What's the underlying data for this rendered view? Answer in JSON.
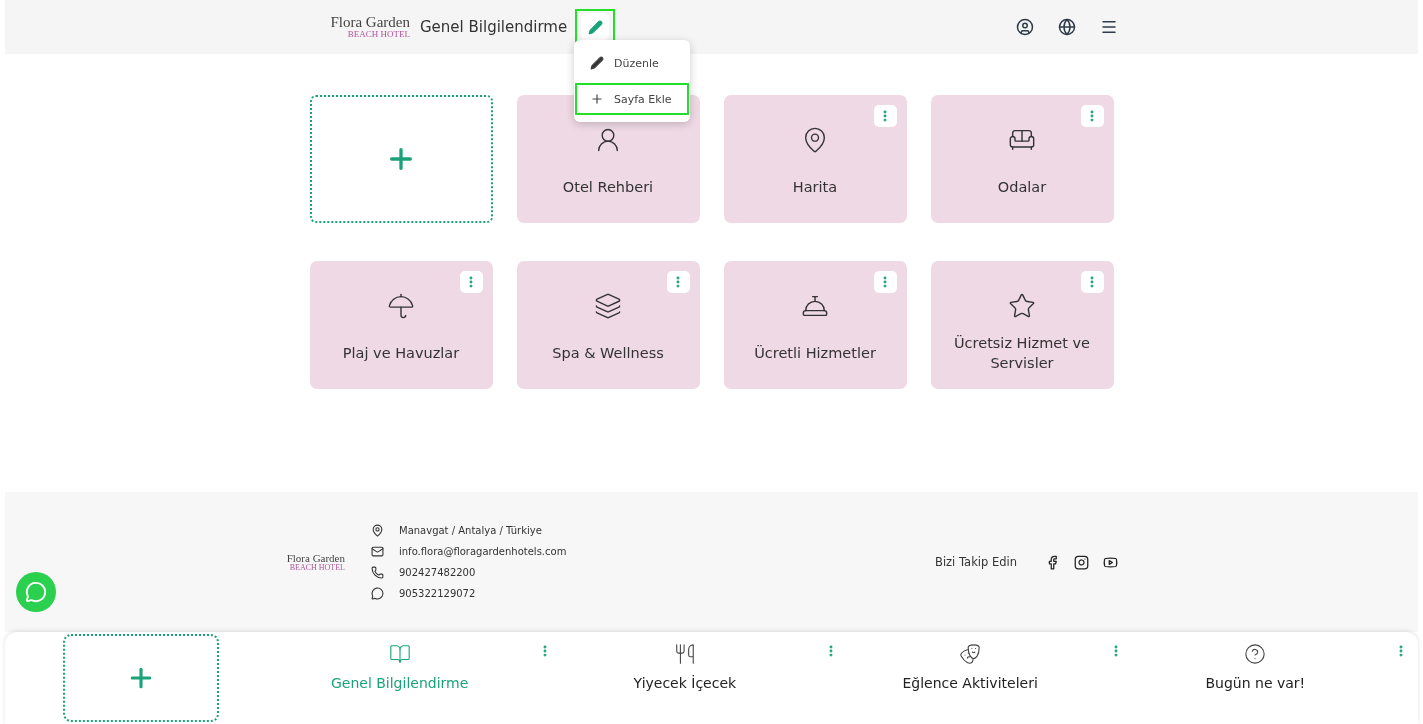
{
  "header": {
    "page_title": "Genel Bilgilendirme",
    "edit_button": {
      "highlighted": true
    },
    "logo": {
      "name": "Flora Garden",
      "sub": "BEACH HOTEL"
    }
  },
  "edit_menu": [
    {
      "label": "Düzenle",
      "kind": "edit",
      "selected": false
    },
    {
      "label": "Sayfa Ekle",
      "kind": "add",
      "selected": true
    }
  ],
  "tiles": [
    {
      "label": "Otel Rehberi"
    },
    {
      "label": "Harita"
    },
    {
      "label": "Odalar"
    },
    {
      "label": "Plaj ve Havuzlar"
    },
    {
      "label": "Spa & Wellness"
    },
    {
      "label": "Ücretli Hizmetler"
    },
    {
      "label": "Ücretsiz Hizmet ve Servisler"
    }
  ],
  "footer": {
    "logo": {
      "name": "Flora Garden",
      "sub": "BEACH HOTEL"
    },
    "contacts": [
      {
        "kind": "address",
        "text": "Manavgat / Antalya / Türkiye"
      },
      {
        "kind": "email",
        "text": "info.flora@floragardenhotels.com"
      },
      {
        "kind": "phone",
        "text": "902427482200"
      },
      {
        "kind": "whatsapp",
        "text": "905322129072"
      }
    ],
    "follow_label": "Bizi Takip Edin"
  },
  "bottom_nav": [
    {
      "label": "Genel Bilgilendirme",
      "selected": true
    },
    {
      "label": "Yiyecek İçecek",
      "selected": false
    },
    {
      "label": "Eğlence Aktiviteleri",
      "selected": false
    },
    {
      "label": "Bugün ne var!",
      "selected": false
    }
  ]
}
